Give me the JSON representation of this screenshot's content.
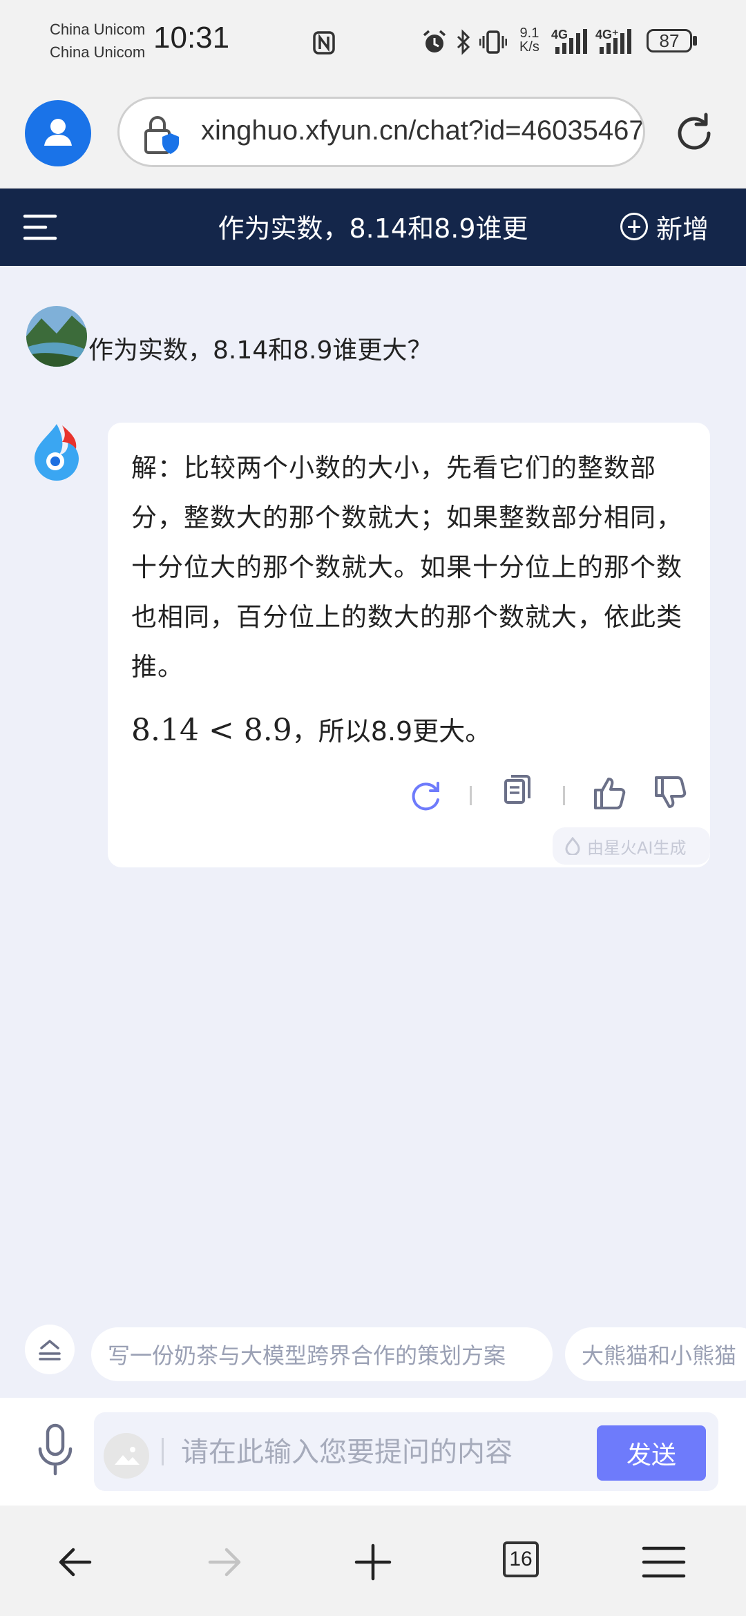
{
  "status_bar": {
    "carrier1": "China Unicom",
    "carrier2": "China Unicom",
    "time": "10:31",
    "net_speed_value": "9.1",
    "net_speed_unit": "K/s",
    "sig1": "4G",
    "sig2": "4G⁺",
    "battery": "87"
  },
  "browser": {
    "url": "xinghuo.xfyun.cn/chat?id=46035467"
  },
  "header": {
    "title": "作为实数，8.14和8.9谁更",
    "new_label": "新增"
  },
  "chat": {
    "user_message": "作为实数，8.14和8.9谁更大？",
    "answer_paragraph": "解：比较两个小数的大小，先看它们的整数部分，整数大的那个数就大；如果整数部分相同，十分位大的那个数就大。如果十分位上的那个数也相同，百分位上的数大的那个数就大，依此类推。",
    "answer_math": "8.14 < 8.9",
    "answer_tail": "，所以8.9更大。",
    "watermark": "由星火AI生成"
  },
  "suggestions": [
    "写一份奶茶与大模型跨界合作的策划方案",
    "大熊猫和小熊猫"
  ],
  "input": {
    "placeholder": "请在此输入您要提问的内容",
    "send_label": "发送"
  },
  "nav": {
    "tab_count": "16"
  },
  "colors": {
    "header_bg": "#14264a",
    "send_button": "#6e7bfb",
    "profile_blue": "#1a73e8"
  }
}
